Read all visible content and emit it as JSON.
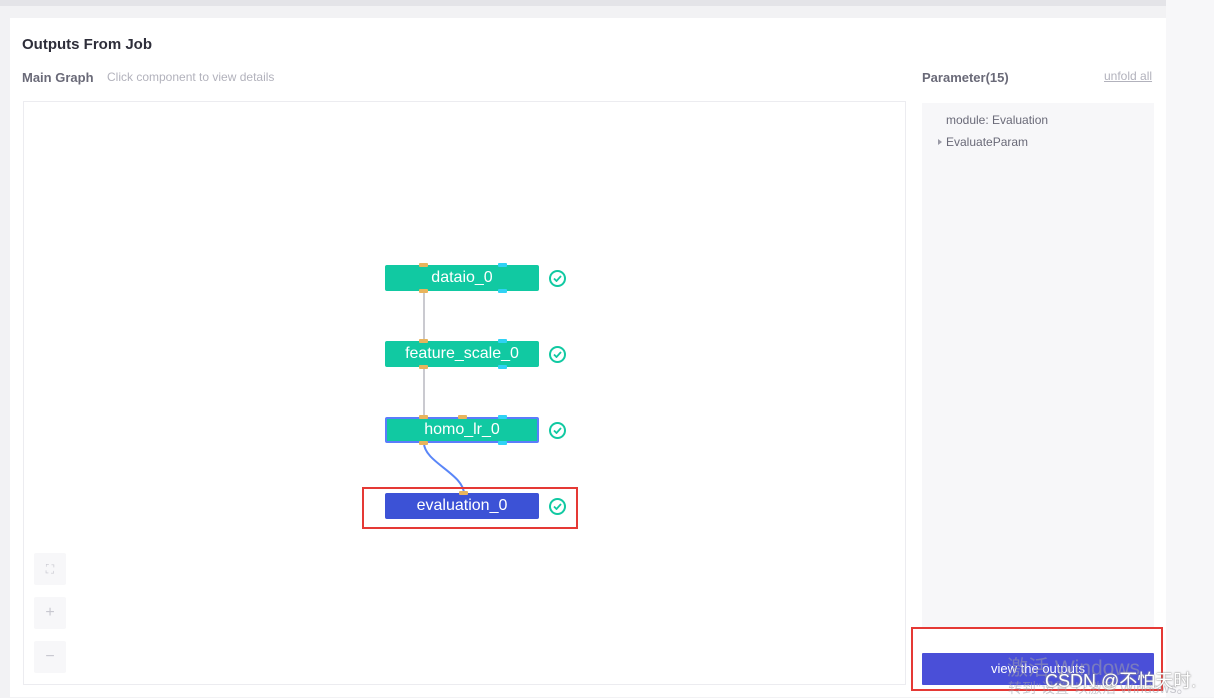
{
  "page": {
    "title": "Outputs From Job"
  },
  "graph": {
    "title": "Main Graph",
    "hint": "Click component to view details",
    "nodes": [
      {
        "label": "dataio_0",
        "status": "success",
        "selected": false
      },
      {
        "label": "feature_scale_0",
        "status": "success",
        "selected": false
      },
      {
        "label": "homo_lr_0",
        "status": "success",
        "selected": false
      },
      {
        "label": "evaluation_0",
        "status": "success",
        "selected": true
      }
    ],
    "controls": {
      "fit_icon": "fullscreen-icon",
      "zoom_in_label": "+",
      "zoom_out_label": "−"
    }
  },
  "parameters": {
    "title": "Parameter(15)",
    "unfold_label": "unfold all",
    "module_line": "module: Evaluation",
    "tree_item": "EvaluateParam"
  },
  "actions": {
    "view_outputs_label": "view the outputs"
  },
  "overlay": {
    "windows_activate_line1": "激活 Windows",
    "windows_activate_line2": "转到\"设置\"以激活 Windows。",
    "csdn_watermark": "CSDN @不怕天时."
  },
  "colors": {
    "node_green": "#11c9a2",
    "node_selected": "#3c52d6",
    "button_primary": "#4a4fd8",
    "highlight_red": "#e53935"
  }
}
